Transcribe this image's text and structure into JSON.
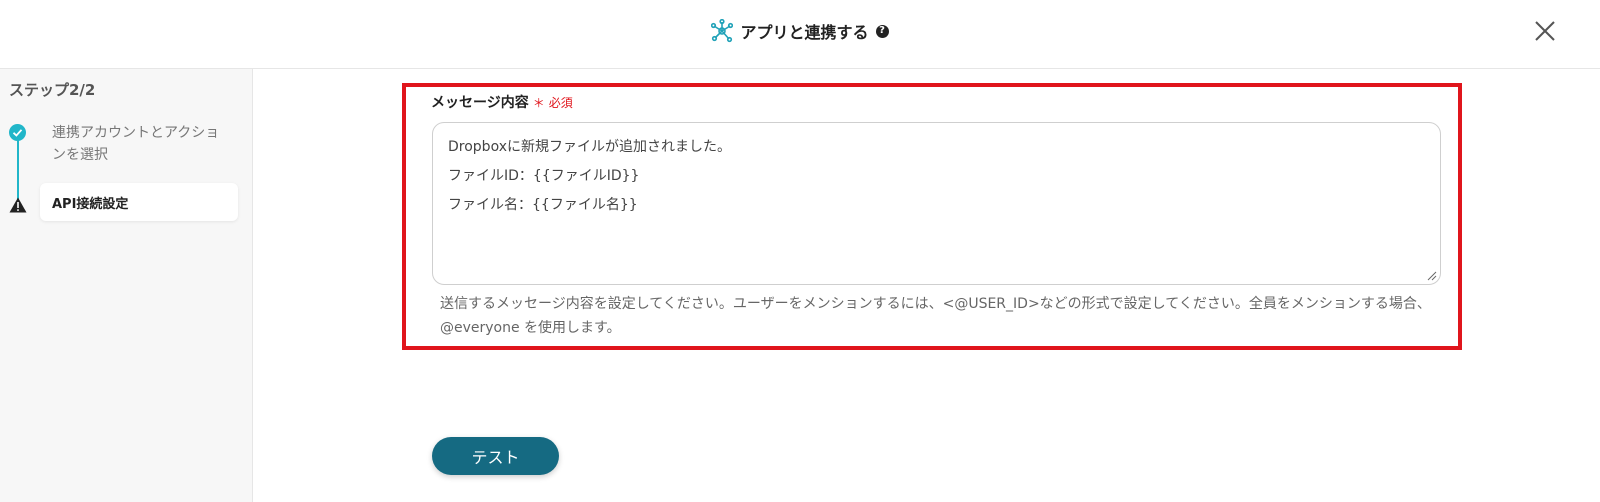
{
  "header": {
    "title": "アプリと連携する",
    "title_icon": "network-hub-icon",
    "help_icon": "question-circle-icon",
    "close_icon": "close-icon"
  },
  "sidebar": {
    "step_heading": "ステップ2/2",
    "steps": [
      {
        "label": "連携アカウントとアクションを選択",
        "status": "completed",
        "icon": "check-circle-icon"
      },
      {
        "label": "API接続設定",
        "status": "warning",
        "icon": "warning-icon"
      }
    ]
  },
  "form": {
    "message_label": "メッセージ内容",
    "required_marker": "＊",
    "required_label": "必須",
    "message_lines": [
      "Dropboxに新規ファイルが追加されました。",
      "ファイルID：{{ファイルID}}",
      "ファイル名：{{ファイル名}}"
    ],
    "help_text": "送信するメッセージ内容を設定してください。ユーザーをメンションするには、<@USER_ID>などの形式で設定してください。全員をメンションする場合、@everyone を使用します。",
    "test_button": "テスト"
  },
  "colors": {
    "accent": "#21b6c9",
    "highlight_frame": "#e0151c",
    "button": "#156a82",
    "required": "#e0151c"
  }
}
